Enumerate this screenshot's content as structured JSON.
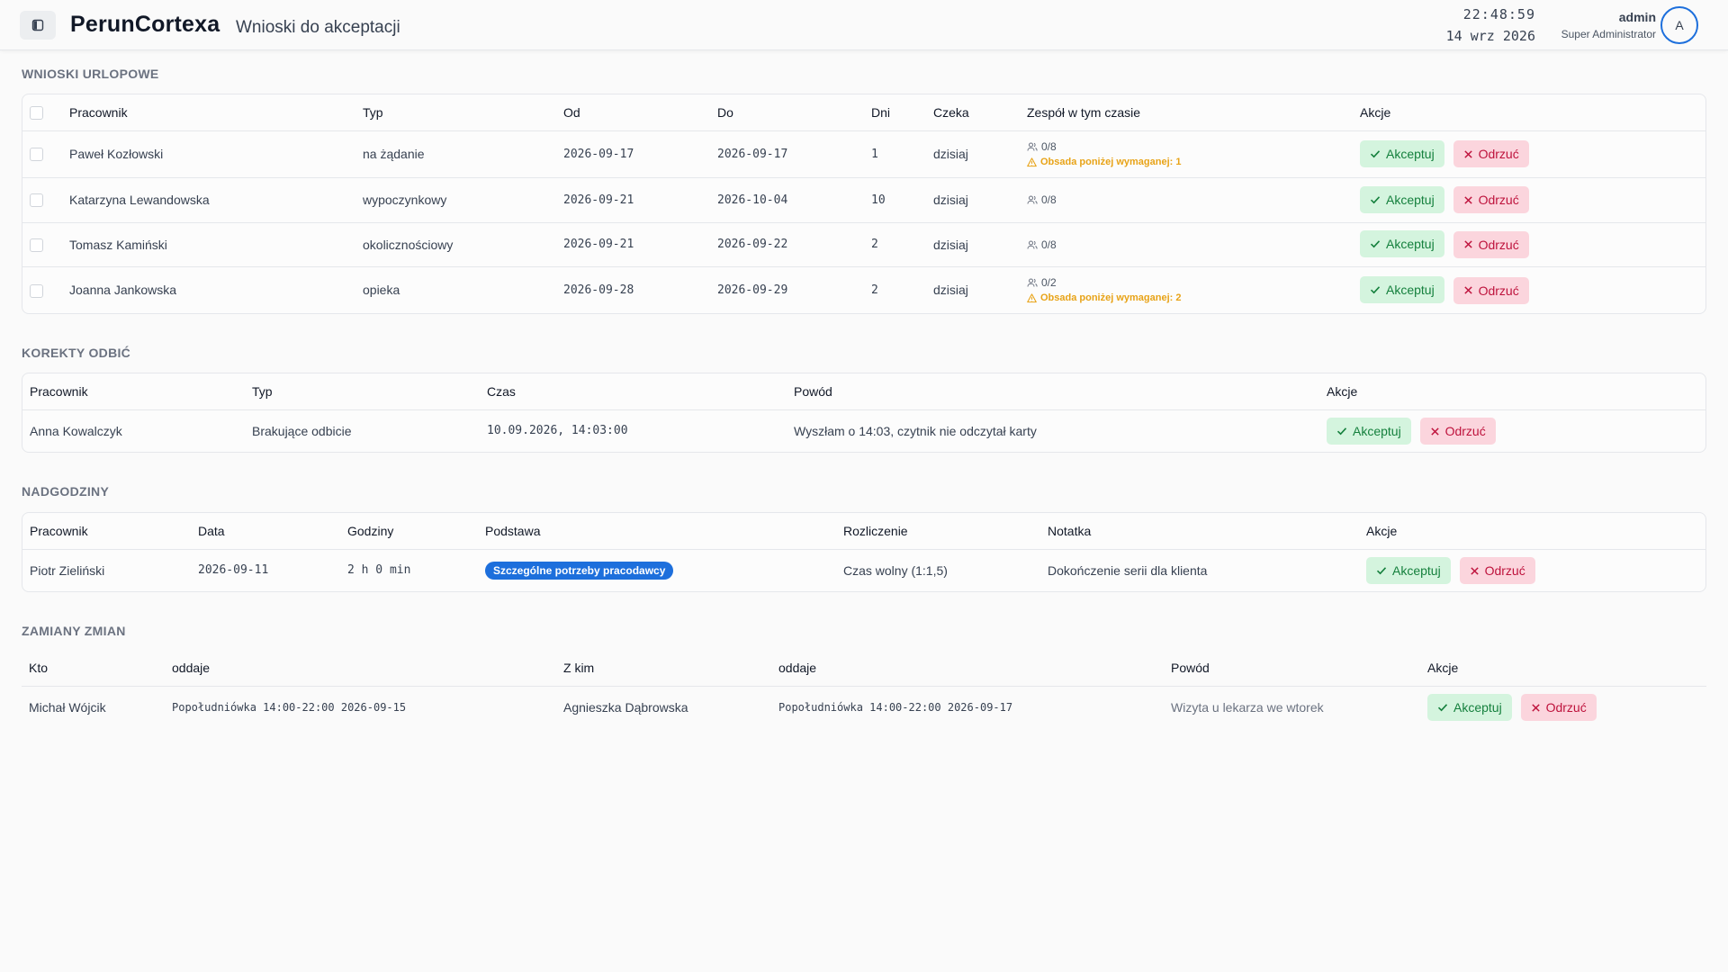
{
  "header": {
    "app_title": "PerunCortexa",
    "page_subtitle": "Wnioski do akceptacji",
    "time": "22:48:59",
    "date": "14 wrz 2026",
    "user_name": "admin",
    "user_role": "Super Administrator",
    "avatar_initial": "A"
  },
  "actions": {
    "accept_label": "Akceptuj",
    "reject_label": "Odrzuć"
  },
  "leave": {
    "title": "WNIOSKI URLOPOWE",
    "columns": [
      "Pracownik",
      "Typ",
      "Od",
      "Do",
      "Dni",
      "Czeka",
      "Zespół w tym czasie",
      "Akcje"
    ],
    "rows": [
      {
        "employee": "Paweł Kozłowski",
        "type": "na żądanie",
        "from": "2026-09-17",
        "to": "2026-09-17",
        "days": "1",
        "waiting": "dzisiaj",
        "team": "0/8",
        "warning": "Obsada poniżej wymaganej: 1"
      },
      {
        "employee": "Katarzyna Lewandowska",
        "type": "wypoczynkowy",
        "from": "2026-09-21",
        "to": "2026-10-04",
        "days": "10",
        "waiting": "dzisiaj",
        "team": "0/8",
        "warning": ""
      },
      {
        "employee": "Tomasz Kamiński",
        "type": "okolicznościowy",
        "from": "2026-09-21",
        "to": "2026-09-22",
        "days": "2",
        "waiting": "dzisiaj",
        "team": "0/8",
        "warning": ""
      },
      {
        "employee": "Joanna Jankowska",
        "type": "opieka",
        "from": "2026-09-28",
        "to": "2026-09-29",
        "days": "2",
        "waiting": "dzisiaj",
        "team": "0/2",
        "warning": "Obsada poniżej wymaganej: 2"
      }
    ]
  },
  "corrections": {
    "title": "KOREKTY ODBIĆ",
    "columns": [
      "Pracownik",
      "Typ",
      "Czas",
      "Powód",
      "Akcje"
    ],
    "rows": [
      {
        "employee": "Anna Kowalczyk",
        "type": "Brakujące odbicie",
        "time": "10.09.2026, 14:03:00",
        "reason": "Wyszłam o 14:03, czytnik nie odczytał karty"
      }
    ]
  },
  "overtime": {
    "title": "NADGODZINY",
    "columns": [
      "Pracownik",
      "Data",
      "Godziny",
      "Podstawa",
      "Rozliczenie",
      "Notatka",
      "Akcje"
    ],
    "rows": [
      {
        "employee": "Piotr Zieliński",
        "date": "2026-09-11",
        "hours": "2 h 0 min",
        "basis": "Szczególne potrzeby pracodawcy",
        "settlement": "Czas wolny (1:1,5)",
        "note": "Dokończenie serii dla klienta"
      }
    ]
  },
  "swaps": {
    "title": "ZAMIANY ZMIAN",
    "columns": [
      "Kto",
      "oddaje",
      "Z kim",
      "oddaje",
      "Powód",
      "Akcje"
    ],
    "rows": [
      {
        "who": "Michał Wójcik",
        "gives": "Popołudniówka 14:00-22:00 2026-09-15",
        "with": "Agnieszka Dąbrowska",
        "gives2": "Popołudniówka 14:00-22:00 2026-09-17",
        "reason": "Wizyta u lekarza we wtorek"
      }
    ]
  },
  "colors": {
    "accent": "#1d6fdc",
    "accept_bg": "#d4f4de",
    "accept_fg": "#15803d",
    "reject_bg": "#fbd5dd",
    "reject_fg": "#be123c",
    "warning": "#e8a317"
  }
}
